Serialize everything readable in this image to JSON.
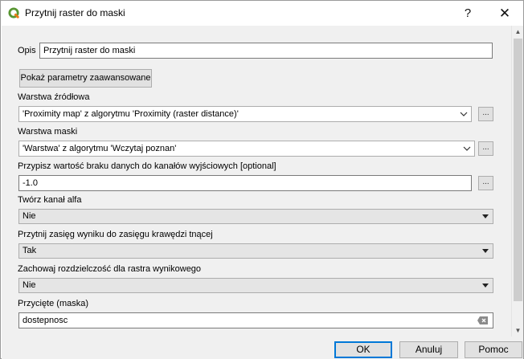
{
  "window": {
    "title": "Przytnij raster do maski",
    "help_label": "?",
    "close_label": "✕"
  },
  "form": {
    "opis_label": "Opis",
    "opis_value": "Przytnij raster do maski",
    "advanced_button": "Pokaż parametry zaawansowane",
    "source_layer_label": "Warstwa źródłowa",
    "source_layer_value": "'Proximity map' z algorytmu 'Proximity (raster distance)'",
    "mask_layer_label": "Warstwa maski",
    "mask_layer_value": "'Warstwa' z algorytmu 'Wczytaj poznan'",
    "nodata_label": "Przypisz wartość braku danych do kanałów wyjściowych [optional]",
    "nodata_value": "-1.0",
    "alpha_label": "Twórz kanał alfa",
    "alpha_value": "Nie",
    "crop_label": "Przytnij zasięg wyniku do zasięgu krawędzi tnącej",
    "crop_value": "Tak",
    "resolution_label": "Zachowaj rozdzielczość dla rastra wynikowego",
    "resolution_value": "Nie",
    "output_label": "Przycięte (maska)",
    "output_value": "dostepnosc",
    "browse_label": "..."
  },
  "footer": {
    "ok_label": "OK",
    "cancel_label": "Anuluj",
    "help_label": "Pomoc"
  }
}
